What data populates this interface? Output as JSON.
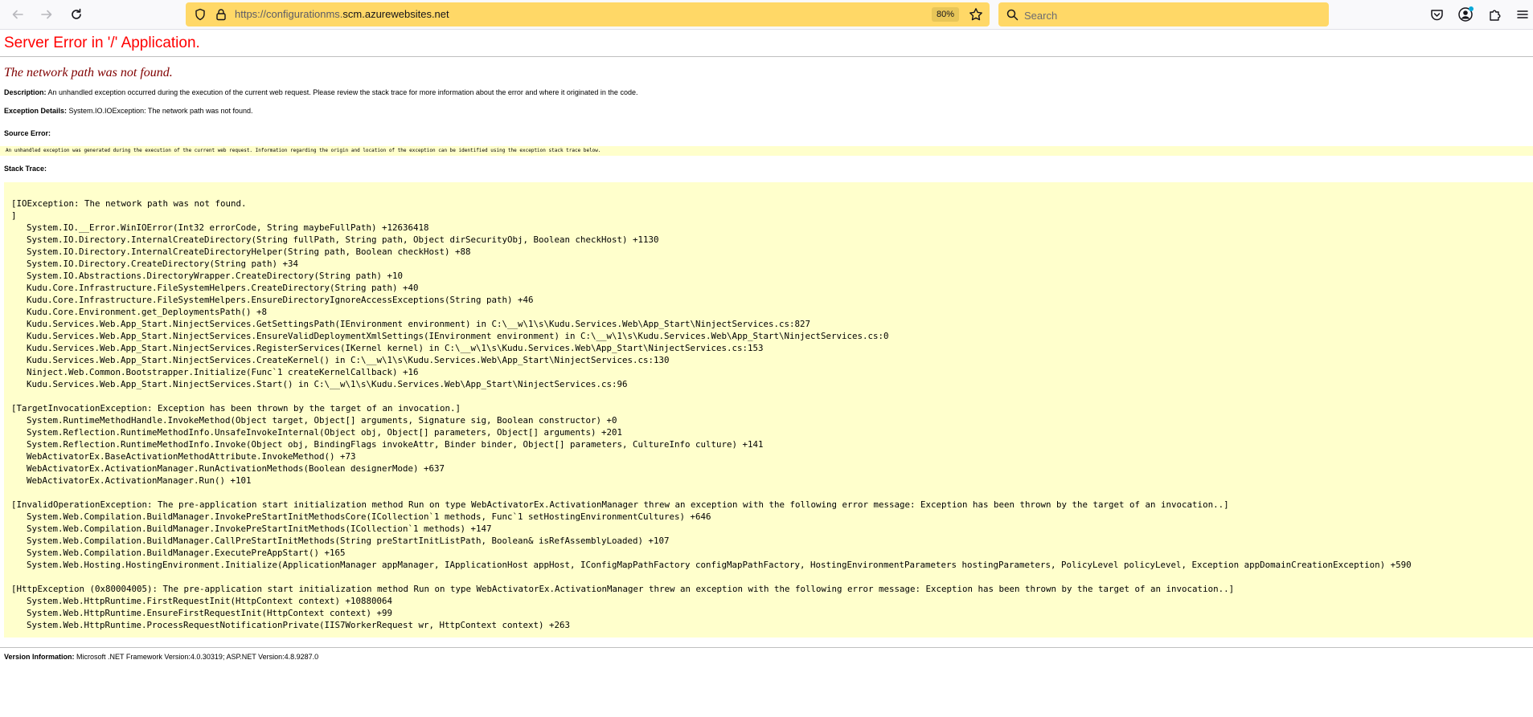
{
  "browser": {
    "url_prefix": "https://configurationms.",
    "url_host": "scm.azurewebsites.net",
    "zoom": "80%",
    "search_placeholder": "Search"
  },
  "page": {
    "title": "Server Error in '/' Application.",
    "subtitle": "The network path was not found.",
    "description_label": "Description:",
    "description_text": "An unhandled exception occurred during the execution of the current web request. Please review the stack trace for more information about the error and where it originated in the code.",
    "exception_label": "Exception Details:",
    "exception_text": "System.IO.IOException: The network path was not found.",
    "source_error_label": "Source Error:",
    "source_error_text": "An unhandled exception was generated during the execution of the current web request. Information regarding the origin and location of the exception can be identified using the exception stack trace below.",
    "stack_trace_label": "Stack Trace:",
    "stack_lines": [
      {
        "t": "[IOException: The network path was not found.",
        "i": false
      },
      {
        "t": "]",
        "i": false
      },
      {
        "t": "System.IO.__Error.WinIOError(Int32 errorCode, String maybeFullPath) +12636418",
        "i": true
      },
      {
        "t": "System.IO.Directory.InternalCreateDirectory(String fullPath, String path, Object dirSecurityObj, Boolean checkHost) +1130",
        "i": true
      },
      {
        "t": "System.IO.Directory.InternalCreateDirectoryHelper(String path, Boolean checkHost) +88",
        "i": true
      },
      {
        "t": "System.IO.Directory.CreateDirectory(String path) +34",
        "i": true
      },
      {
        "t": "System.IO.Abstractions.DirectoryWrapper.CreateDirectory(String path) +10",
        "i": true
      },
      {
        "t": "Kudu.Core.Infrastructure.FileSystemHelpers.CreateDirectory(String path) +40",
        "i": true
      },
      {
        "t": "Kudu.Core.Infrastructure.FileSystemHelpers.EnsureDirectoryIgnoreAccessExceptions(String path) +46",
        "i": true
      },
      {
        "t": "Kudu.Core.Environment.get_DeploymentsPath() +8",
        "i": true
      },
      {
        "t": "Kudu.Services.Web.App_Start.NinjectServices.GetSettingsPath(IEnvironment environment) in C:\\__w\\1\\s\\Kudu.Services.Web\\App_Start\\NinjectServices.cs:827",
        "i": true
      },
      {
        "t": "Kudu.Services.Web.App_Start.NinjectServices.EnsureValidDeploymentXmlSettings(IEnvironment environment) in C:\\__w\\1\\s\\Kudu.Services.Web\\App_Start\\NinjectServices.cs:0",
        "i": true
      },
      {
        "t": "Kudu.Services.Web.App_Start.NinjectServices.RegisterServices(IKernel kernel) in C:\\__w\\1\\s\\Kudu.Services.Web\\App_Start\\NinjectServices.cs:153",
        "i": true
      },
      {
        "t": "Kudu.Services.Web.App_Start.NinjectServices.CreateKernel() in C:\\__w\\1\\s\\Kudu.Services.Web\\App_Start\\NinjectServices.cs:130",
        "i": true
      },
      {
        "t": "Ninject.Web.Common.Bootstrapper.Initialize(Func`1 createKernelCallback) +16",
        "i": true
      },
      {
        "t": "Kudu.Services.Web.App_Start.NinjectServices.Start() in C:\\__w\\1\\s\\Kudu.Services.Web\\App_Start\\NinjectServices.cs:96",
        "i": true
      },
      {
        "t": "",
        "i": false
      },
      {
        "t": "[TargetInvocationException: Exception has been thrown by the target of an invocation.]",
        "i": false
      },
      {
        "t": "System.RuntimeMethodHandle.InvokeMethod(Object target, Object[] arguments, Signature sig, Boolean constructor) +0",
        "i": true
      },
      {
        "t": "System.Reflection.RuntimeMethodInfo.UnsafeInvokeInternal(Object obj, Object[] parameters, Object[] arguments) +201",
        "i": true
      },
      {
        "t": "System.Reflection.RuntimeMethodInfo.Invoke(Object obj, BindingFlags invokeAttr, Binder binder, Object[] parameters, CultureInfo culture) +141",
        "i": true
      },
      {
        "t": "WebActivatorEx.BaseActivationMethodAttribute.InvokeMethod() +73",
        "i": true
      },
      {
        "t": "WebActivatorEx.ActivationManager.RunActivationMethods(Boolean designerMode) +637",
        "i": true
      },
      {
        "t": "WebActivatorEx.ActivationManager.Run() +101",
        "i": true
      },
      {
        "t": "",
        "i": false
      },
      {
        "t": "[InvalidOperationException: The pre-application start initialization method Run on type WebActivatorEx.ActivationManager threw an exception with the following error message: Exception has been thrown by the target of an invocation..]",
        "i": false
      },
      {
        "t": "System.Web.Compilation.BuildManager.InvokePreStartInitMethodsCore(ICollection`1 methods, Func`1 setHostingEnvironmentCultures) +646",
        "i": true
      },
      {
        "t": "System.Web.Compilation.BuildManager.InvokePreStartInitMethods(ICollection`1 methods) +147",
        "i": true
      },
      {
        "t": "System.Web.Compilation.BuildManager.CallPreStartInitMethods(String preStartInitListPath, Boolean& isRefAssemblyLoaded) +107",
        "i": true
      },
      {
        "t": "System.Web.Compilation.BuildManager.ExecutePreAppStart() +165",
        "i": true
      },
      {
        "t": "System.Web.Hosting.HostingEnvironment.Initialize(ApplicationManager appManager, IApplicationHost appHost, IConfigMapPathFactory configMapPathFactory, HostingEnvironmentParameters hostingParameters, PolicyLevel policyLevel, Exception appDomainCreationException) +590",
        "i": true
      },
      {
        "t": "",
        "i": false
      },
      {
        "t": "[HttpException (0x80004005): The pre-application start initialization method Run on type WebActivatorEx.ActivationManager threw an exception with the following error message: Exception has been thrown by the target of an invocation..]",
        "i": false
      },
      {
        "t": "System.Web.HttpRuntime.FirstRequestInit(HttpContext context) +10880064",
        "i": true
      },
      {
        "t": "System.Web.HttpRuntime.EnsureFirstRequestInit(HttpContext context) +99",
        "i": true
      },
      {
        "t": "System.Web.HttpRuntime.ProcessRequestNotificationPrivate(IIS7WorkerRequest wr, HttpContext context) +263",
        "i": true
      }
    ],
    "version_label": "Version Information:",
    "version_text": "Microsoft .NET Framework Version:4.0.30319; ASP.NET Version:4.8.9287.0"
  },
  "colors": {
    "title": "#ff0000",
    "subtitle": "#800000",
    "code_background": "#ffffcc",
    "urlbar": "#ffd867"
  },
  "icons": [
    "back-icon",
    "forward-icon",
    "reload-icon",
    "shield-icon",
    "lock-icon",
    "star-icon",
    "search-icon",
    "pocket-icon",
    "account-icon",
    "extensions-icon",
    "menu-icon"
  ]
}
